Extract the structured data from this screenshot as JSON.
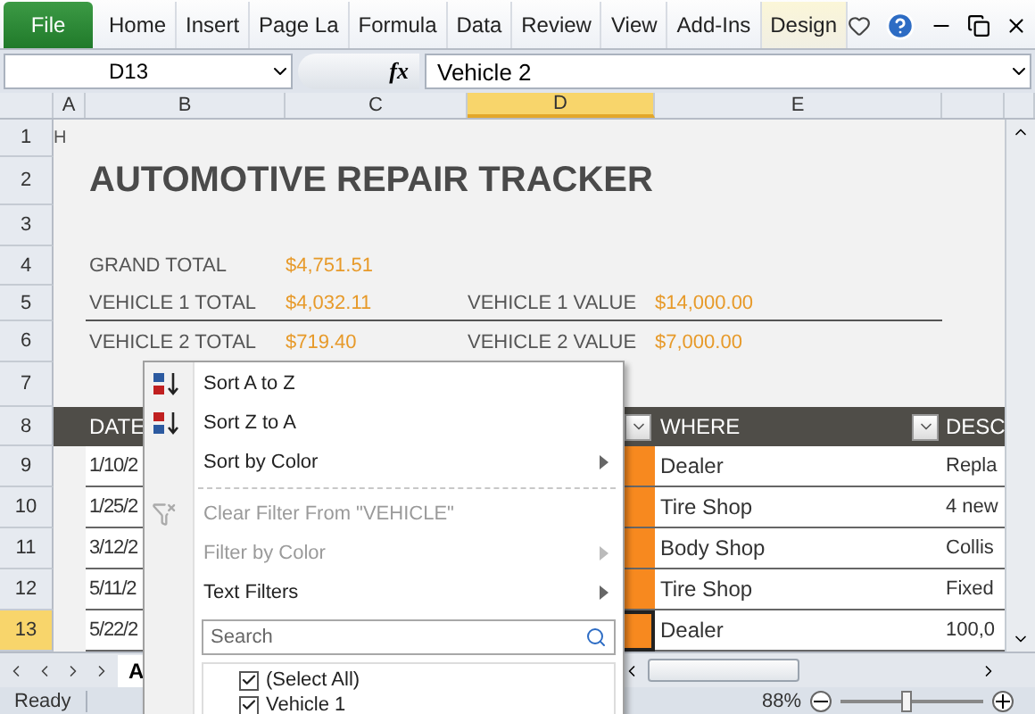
{
  "ribbon": {
    "tabs": [
      {
        "label": "File",
        "kind": "file"
      },
      {
        "label": "Home",
        "kind": "tab"
      },
      {
        "label": "Insert",
        "kind": "tab"
      },
      {
        "label": "Page La",
        "kind": "tab"
      },
      {
        "label": "Formula",
        "kind": "tab"
      },
      {
        "label": "Data",
        "kind": "tab"
      },
      {
        "label": "Review",
        "kind": "tab"
      },
      {
        "label": "View",
        "kind": "tab"
      },
      {
        "label": "Add-Ins",
        "kind": "tab"
      },
      {
        "label": "Design",
        "kind": "contextual"
      }
    ]
  },
  "formula_bar": {
    "name_box": "D13",
    "fx_label": "fx",
    "value": "Vehicle 2"
  },
  "columns": [
    {
      "label": "A",
      "selected": false
    },
    {
      "label": "B",
      "selected": false
    },
    {
      "label": "C",
      "selected": false
    },
    {
      "label": "D",
      "selected": true
    },
    {
      "label": "E",
      "selected": false
    }
  ],
  "row_numbers": [
    {
      "label": "1",
      "selected": false
    },
    {
      "label": "2",
      "selected": false
    },
    {
      "label": "3",
      "selected": false
    },
    {
      "label": "4",
      "selected": false
    },
    {
      "label": "5",
      "selected": false
    },
    {
      "label": "6",
      "selected": false
    },
    {
      "label": "7",
      "selected": false
    },
    {
      "label": "8",
      "selected": false
    },
    {
      "label": "9",
      "selected": false
    },
    {
      "label": "10",
      "selected": false
    },
    {
      "label": "11",
      "selected": false
    },
    {
      "label": "12",
      "selected": false
    },
    {
      "label": "13",
      "selected": true
    }
  ],
  "sheet": {
    "corner_text": "H",
    "title": "AUTOMOTIVE REPAIR TRACKER",
    "grand_total": {
      "label": "GRAND TOTAL",
      "value": "$4,751.51"
    },
    "vehicles": [
      {
        "total_label": "VEHICLE 1 TOTAL",
        "total": "$4,032.11",
        "value_label": "VEHICLE 1  VALUE",
        "value": "$14,000.00"
      },
      {
        "total_label": "VEHICLE 2 TOTAL",
        "total": "$719.40",
        "value_label": "VEHICLE 2  VALUE",
        "value": "$7,000.00"
      }
    ]
  },
  "table": {
    "headers": {
      "date": "DATE",
      "where": "WHERE",
      "description": "DESC"
    },
    "rows": [
      {
        "date": "1/10/2",
        "where": "Dealer",
        "description": "Repla",
        "selected": false
      },
      {
        "date": "1/25/2",
        "where": "Tire Shop",
        "description": "4 new",
        "selected": false
      },
      {
        "date": "3/12/2",
        "where": "Body Shop",
        "description": "Collis",
        "selected": false
      },
      {
        "date": "5/11/2",
        "where": "Tire Shop",
        "description": "Fixed",
        "selected": false
      },
      {
        "date": "5/22/2",
        "where": "Dealer",
        "description": "100,0",
        "selected": true
      }
    ]
  },
  "filter_menu": {
    "items": [
      {
        "kind": "sort_asc",
        "label": "Sort A to Z",
        "disabled": false,
        "submenu": false
      },
      {
        "kind": "sort_desc",
        "label": "Sort Z to A",
        "disabled": false,
        "submenu": false
      },
      {
        "kind": "plain",
        "label": "Sort by Color",
        "disabled": false,
        "submenu": true
      },
      {
        "kind": "separator"
      },
      {
        "kind": "clear",
        "label": "Clear Filter From \"VEHICLE\"",
        "disabled": true,
        "submenu": false
      },
      {
        "kind": "plain",
        "label": "Filter by Color",
        "disabled": true,
        "submenu": true
      },
      {
        "kind": "plain",
        "label": "Text Filters",
        "disabled": false,
        "submenu": true
      }
    ],
    "search": {
      "placeholder": "Search"
    },
    "options": [
      {
        "label": "(Select All)",
        "checked": true
      },
      {
        "label": "Vehicle 1",
        "checked": true
      }
    ]
  },
  "sheet_tabs": [
    {
      "label": "A",
      "selected": true
    }
  ],
  "status_bar": {
    "status": "Ready",
    "zoom": "88%",
    "zoom_level": {
      "level": 0.46
    }
  }
}
